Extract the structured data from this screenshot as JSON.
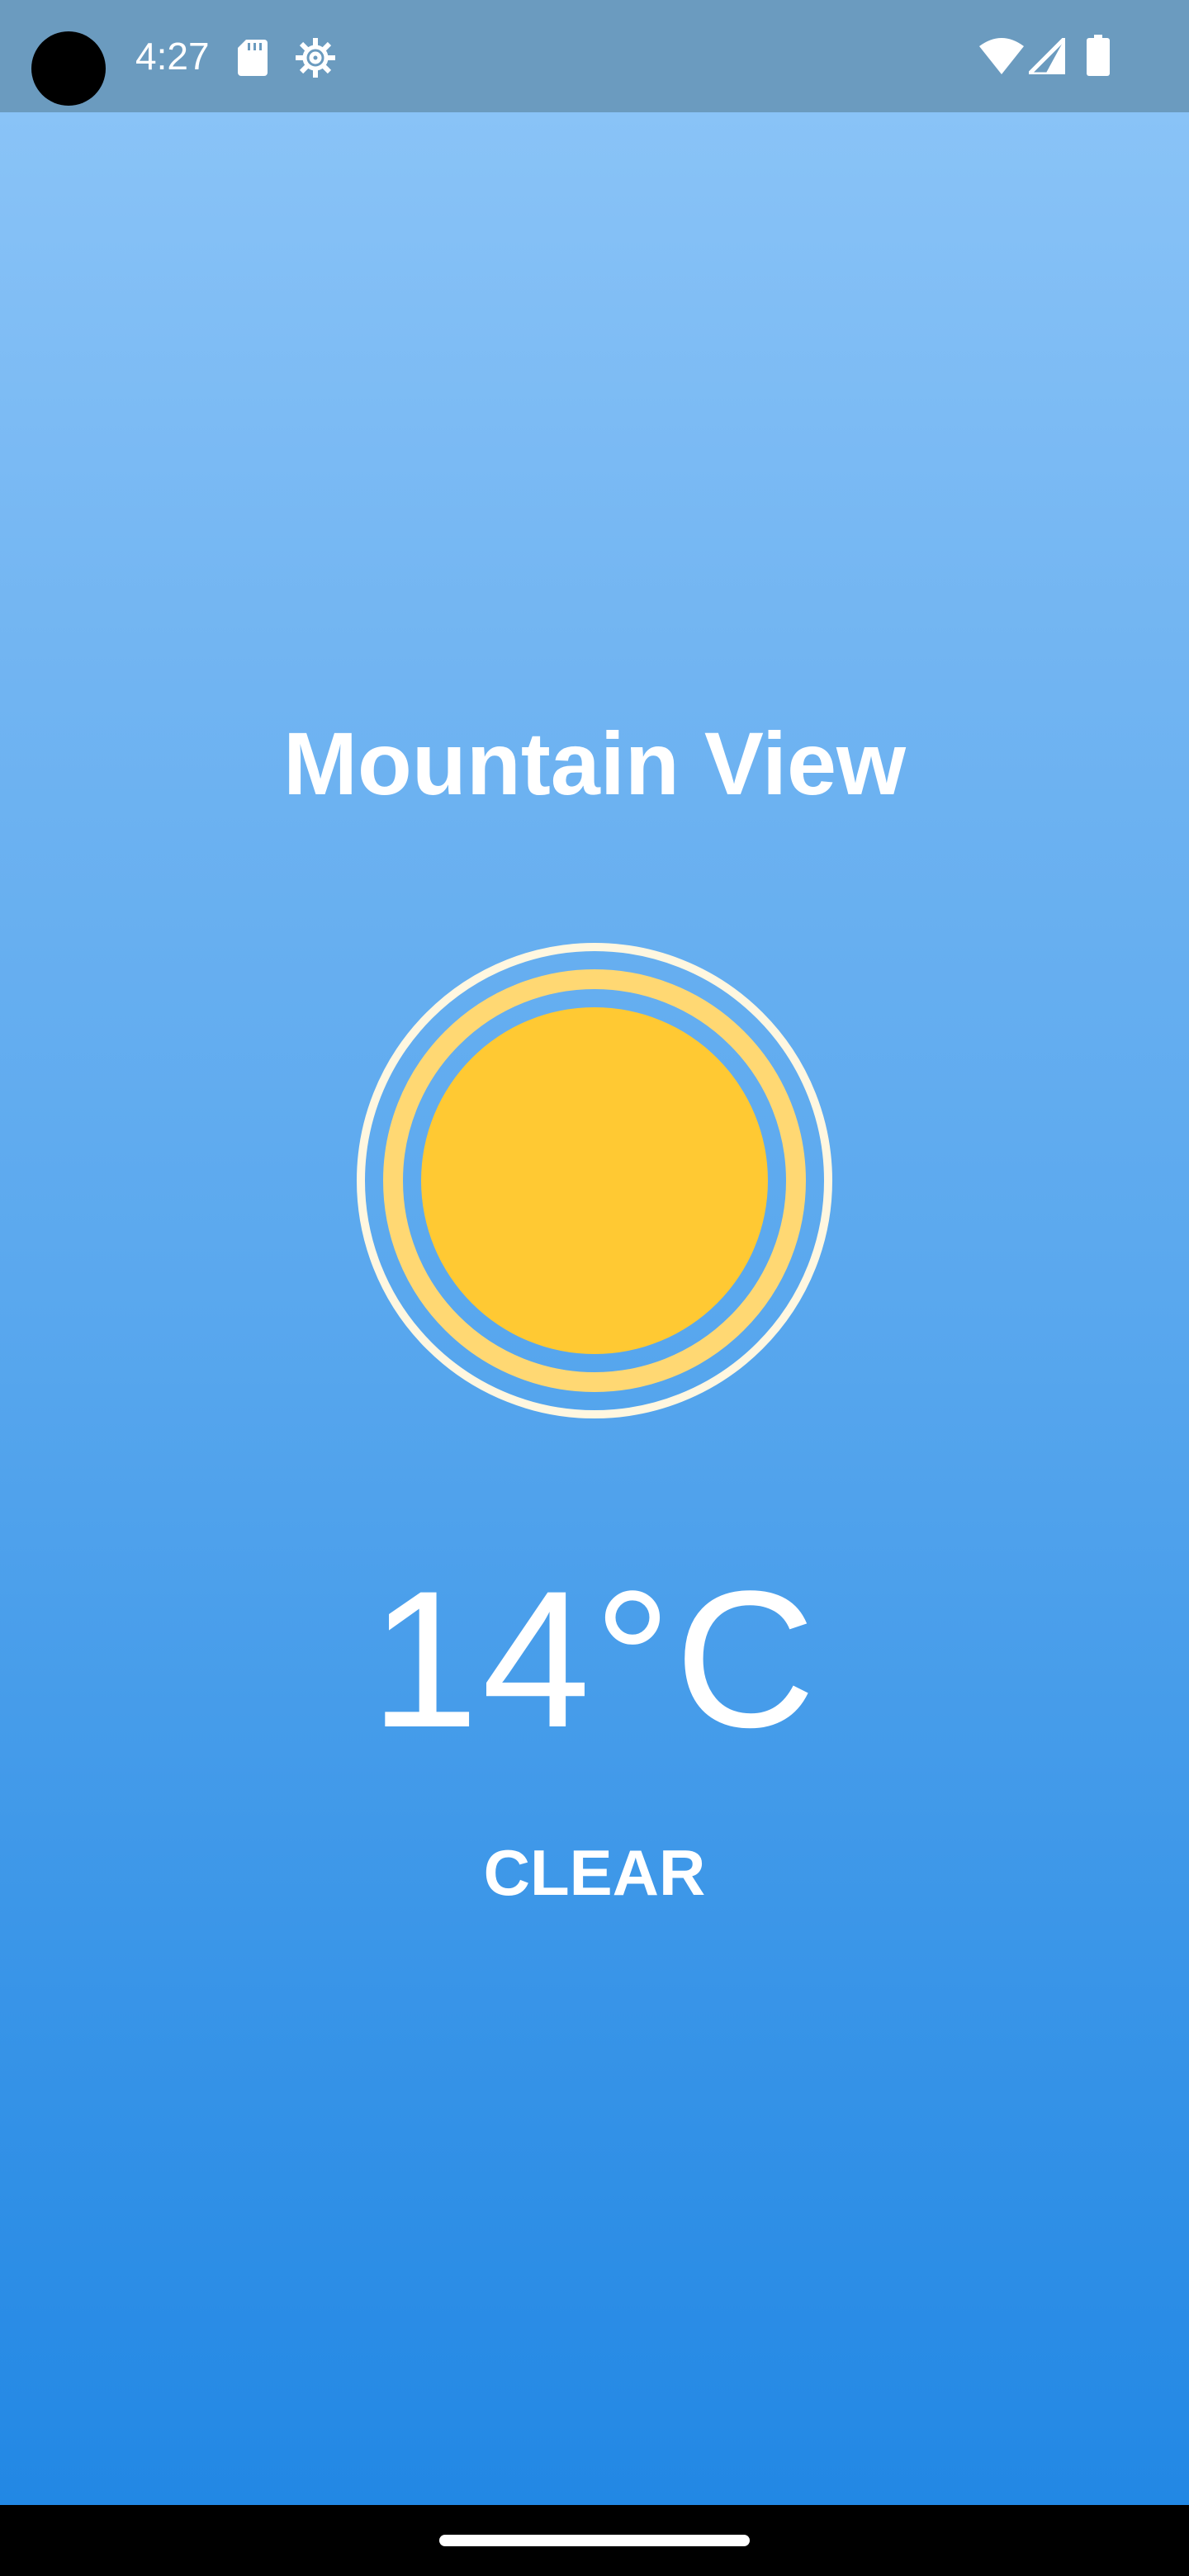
{
  "status_bar": {
    "time": "4:27",
    "icons": [
      "camera-cutout",
      "sd-card-icon",
      "settings-gear-icon",
      "wifi-icon",
      "cell-signal-icon",
      "battery-icon"
    ],
    "background_color": "#6b9bbf"
  },
  "weather": {
    "city": "Mountain View",
    "temperature": "14°C",
    "condition": "CLEAR",
    "icon": "sun-icon"
  },
  "colors": {
    "sky_top": "#8ec6f8",
    "sky_bottom": "#1f86e4",
    "sun_core": "#ffc933",
    "sun_ring": "#ffd873",
    "sun_outer_ring": "#fff7e0",
    "text": "#ffffff"
  }
}
